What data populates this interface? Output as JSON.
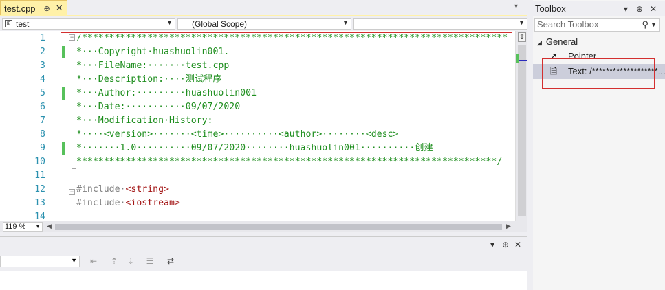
{
  "doc_tab": {
    "label": "test.cpp",
    "pin": "⊕",
    "close": "✕"
  },
  "tab_overflow": "▾",
  "navbar": {
    "project": "test",
    "scope": "(Global Scope)",
    "member": ""
  },
  "editor": {
    "lines": [
      {
        "n": "1",
        "text": "/******************************************************************************"
      },
      {
        "n": "2",
        "text": "*···Copyright·huashuolin001."
      },
      {
        "n": "3",
        "text": "*···FileName:·······test.cpp"
      },
      {
        "n": "4",
        "text": "*···Description:····测试程序"
      },
      {
        "n": "5",
        "text": "*···Author:·········huashuolin001"
      },
      {
        "n": "6",
        "text": "*···Date:···········09/07/2020"
      },
      {
        "n": "7",
        "text": "*···Modification·History:"
      },
      {
        "n": "8",
        "text": "*····<version>·······<time>··········<author>········<desc>"
      },
      {
        "n": "9",
        "text": "*·······1.0··········09/07/2020········huashuolin001··········创建"
      },
      {
        "n": "10",
        "text": "*****************************************************************************/"
      },
      {
        "n": "11",
        "text": ""
      },
      {
        "n": "12",
        "kw": "#include·",
        "str": "<string>"
      },
      {
        "n": "13",
        "kw": "#include·",
        "str": "<iostream>"
      },
      {
        "n": "14",
        "text": ""
      }
    ]
  },
  "zoom": "119 %",
  "toolbox": {
    "title": "Toolbox",
    "search_placeholder": "Search Toolbox",
    "group": "General",
    "items": [
      {
        "label": "Pointer"
      },
      {
        "label": "Text: /*******************..."
      }
    ]
  },
  "colors": {
    "comment": "#1e8e1e",
    "line_number": "#2b91af",
    "change_bar": "#57c15b",
    "highlight_box": "#d32f2f",
    "tab_active": "#fff1a8"
  }
}
